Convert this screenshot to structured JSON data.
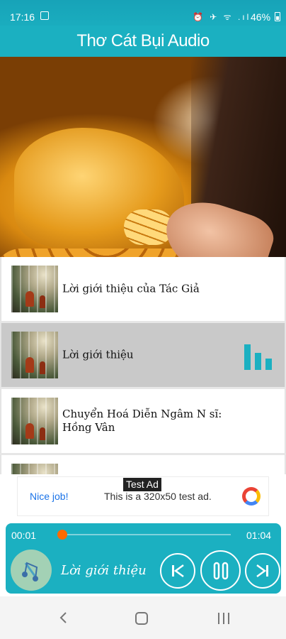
{
  "status_bar": {
    "time": "17:16",
    "icons": "⏰ ✈ ᯤ .ıl",
    "battery": "46%"
  },
  "app": {
    "title": "Thơ Cát Bụi Audio",
    "accent": "#1bb0c1"
  },
  "playlist": {
    "items": [
      {
        "label": "Lời giới thiệu của Tác Giả",
        "active": false
      },
      {
        "label": "Lời giới thiệu",
        "active": true
      },
      {
        "label": "Chuyển Hoá Diễn Ngâm N sĩ: Hồng Vân",
        "active": false
      }
    ],
    "active_indicator_icon": "equalizer-icon"
  },
  "ad": {
    "tag": "Test Ad",
    "nice_text": "Nice job!",
    "text": "This is a 320x50 test ad."
  },
  "player": {
    "current_time": "00:01",
    "total_time": "01:04",
    "progress": 0.015,
    "now_playing": "Lời giới thiệu",
    "controls": [
      "skip-previous-icon",
      "pause-icon",
      "skip-next-icon"
    ]
  },
  "nav": {
    "icons": [
      "back-icon",
      "home-icon",
      "recents-icon"
    ]
  }
}
